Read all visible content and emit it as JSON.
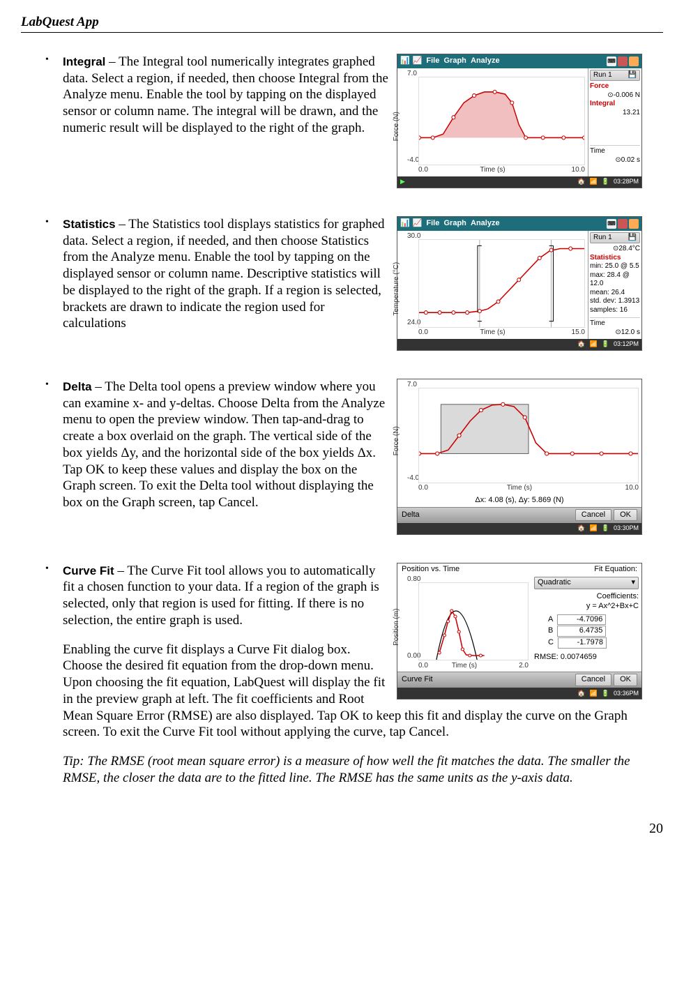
{
  "header": "LabQuest App",
  "page_number": "20",
  "bullets": {
    "integral": {
      "term": "Integral",
      "text": " – The Integral tool numerically integrates graphed data. Select a region, if needed, then choose Integral from the Analyze menu. Enable the tool by tapping on the displayed sensor or column name. The integral will be drawn, and the numeric result will be displayed to the right of the graph."
    },
    "statistics": {
      "term": "Statistics",
      "text": " – The Statistics tool displays statistics for graphed data. Select a region, if needed, and then choose Statistics from the Analyze menu. Enable the tool by tapping on the displayed sensor or column name. Descriptive statistics will be displayed to the right of the graph. If a region is selected, brackets are drawn to indicate the region used for calculations"
    },
    "delta": {
      "term": "Delta",
      "text": " – The Delta tool opens a preview window where you can examine x- and y-deltas. Choose Delta from the Analyze menu to open the preview window. Then tap-and-drag to create a box overlaid on the graph. The vertical side of the box yields Δy, and the horizontal side of the box yields Δx. Tap OK to keep these values and display the box on the Graph screen. To exit the Delta tool without displaying the box on  the Graph screen, tap Cancel."
    },
    "curvefit": {
      "term": "Curve Fit",
      "text1": " – The Curve Fit tool allows you to automatically fit a chosen function to your data. If a region of the graph is selected, only that region is used for fitting. If there is no selection, the entire graph is used.",
      "text2": "Enabling the curve fit displays a Curve Fit dialog box. Choose the desired fit equation from the drop-down menu. Upon choosing the fit equation, LabQuest will display the fit in the preview graph at left. The fit coefficients and Root Mean Square Error (RMSE) are also displayed. Tap OK to keep this fit and display the curve on the Graph screen. To exit the Curve Fit tool without applying the curve, tap Cancel.",
      "tip": "Tip: The RMSE (root mean square error) is a measure of how well the fit matches the data. The smaller the RMSE, the closer the data are to the fitted line. The RMSE has the same units as the y-axis data."
    }
  },
  "menus": {
    "file": "File",
    "graph": "Graph",
    "analyze": "Analyze"
  },
  "shot1": {
    "run": "Run 1",
    "force_label": "Force",
    "force_val": "⊙-0.006 N",
    "integral_label": "Integral",
    "integral_val": "13.21",
    "time_label": "Time",
    "time_val": "⊙0.02 s",
    "ylabel": "Force (N)",
    "xlabel": "Time (s)",
    "ymax": "7.0",
    "ymin": "-4.0",
    "xmin": "0.0",
    "xmax": "10.0",
    "clock": "03:28PM"
  },
  "shot2": {
    "run": "Run 1",
    "cur_val": "⊙28.4°C",
    "stats_label": "Statistics",
    "min": "min: 25.0 @ 5.5",
    "max": "max: 28.4 @ 12.0",
    "mean": "mean: 26.4",
    "std": "std. dev: 1.3913",
    "samples": "samples: 16",
    "time_label": "Time",
    "time_val": "⊙12.0 s",
    "ylabel": "Temperature (°C)",
    "xlabel": "Time (s)",
    "ymax": "30.0",
    "ymin": "24.0",
    "xmin": "0.0",
    "xmax": "15.0",
    "clock": "03:12PM"
  },
  "shot3": {
    "ylabel": "Force (N)",
    "xlabel": "Time (s)",
    "ymax": "7.0",
    "ymin": "-4.0",
    "xmin": "0.0",
    "xmax": "10.0",
    "delta_text": "Δx: 4.08 (s), Δy: 5.869 (N)",
    "title": "Delta",
    "cancel": "Cancel",
    "ok": "OK",
    "clock": "03:30PM"
  },
  "shot4": {
    "chart_title": "Position vs. Time",
    "fit_title": "Fit Equation:",
    "ylabel": "Position (m)",
    "xlabel": "Time (s)",
    "ymax": "0.80",
    "ymin": "0.00",
    "xmin": "0.0",
    "xmax": "2.0",
    "eq_type": "Quadratic",
    "coef_label": "Coefficients:",
    "equation": "y = Ax^2+Bx+C",
    "A": "-4.7096",
    "B": "6.4735",
    "C": "-1.7978",
    "A_lbl": "A",
    "B_lbl": "B",
    "C_lbl": "C",
    "rmse": "RMSE: 0.0074659",
    "title": "Curve Fit",
    "cancel": "Cancel",
    "ok": "OK",
    "clock": "03:36PM"
  },
  "chart_data": [
    {
      "type": "line",
      "title": "Force vs Time (Integral)",
      "xlabel": "Time (s)",
      "ylabel": "Force (N)",
      "xlim": [
        0,
        10
      ],
      "ylim": [
        -4,
        7
      ],
      "series": [
        {
          "name": "Force",
          "x": [
            0,
            0.5,
            1,
            1.5,
            2,
            2.5,
            3,
            3.5,
            4,
            4.5,
            5,
            5.5,
            6,
            6.5,
            7,
            7.5,
            8,
            8.5,
            9,
            9.5,
            10
          ],
          "y": [
            -0.1,
            -0.1,
            0.2,
            1.5,
            3.2,
            4.5,
            5.1,
            5.3,
            5.3,
            5.0,
            4.0,
            1.5,
            -0.1,
            -0.1,
            -0.1,
            -0.1,
            -0.1,
            -0.1,
            -0.1,
            -0.1,
            -0.1
          ]
        }
      ],
      "integral_fill": true
    },
    {
      "type": "line",
      "title": "Temperature vs Time (Statistics)",
      "xlabel": "Time (s)",
      "ylabel": "Temperature (°C)",
      "xlim": [
        0,
        15
      ],
      "ylim": [
        24,
        30
      ],
      "series": [
        {
          "name": "Temperature",
          "x": [
            0,
            1,
            2,
            3,
            4,
            5,
            5.5,
            6,
            7,
            8,
            9,
            10,
            11,
            12,
            13,
            14,
            15
          ],
          "y": [
            25,
            25,
            25,
            25,
            25,
            25,
            25,
            25.3,
            25.6,
            26.2,
            27,
            27.7,
            28.2,
            28.4,
            28.4,
            28.4,
            28.4
          ]
        }
      ],
      "selection": {
        "x0": 5.5,
        "x1": 12.0
      }
    },
    {
      "type": "line",
      "title": "Force vs Time (Delta)",
      "xlabel": "Time (s)",
      "ylabel": "Force (N)",
      "xlim": [
        0,
        10
      ],
      "ylim": [
        -4,
        7
      ],
      "series": [
        {
          "name": "Force",
          "x": [
            0,
            0.5,
            1,
            1.5,
            2,
            2.5,
            3,
            3.5,
            4,
            4.5,
            5,
            5.5,
            6,
            6.5,
            7,
            7.5,
            8,
            8.5,
            9,
            9.5,
            10
          ],
          "y": [
            -0.1,
            -0.1,
            0.2,
            1.5,
            3.2,
            4.5,
            5.1,
            5.3,
            5.3,
            5.0,
            4.0,
            1.5,
            -0.1,
            -0.1,
            -0.1,
            -0.1,
            -0.1,
            -0.1,
            -0.1,
            -0.1,
            -0.1
          ]
        }
      ],
      "delta_box": {
        "x0": 1.0,
        "x1": 5.08,
        "y0": -0.1,
        "y1": 5.77
      }
    },
    {
      "type": "scatter",
      "title": "Position vs. Time (Curve Fit)",
      "xlabel": "Time (s)",
      "ylabel": "Position (m)",
      "xlim": [
        0,
        2
      ],
      "ylim": [
        0,
        0.8
      ],
      "series": [
        {
          "name": "Position",
          "x": [
            0.4,
            0.5,
            0.55,
            0.6,
            0.65,
            0.7,
            0.75,
            0.8,
            0.85,
            0.9,
            0.95,
            1.0
          ],
          "y": [
            0.12,
            0.3,
            0.39,
            0.46,
            0.38,
            0.22,
            0.05,
            0.04,
            0.04,
            0.04,
            0.04,
            0.04
          ]
        }
      ],
      "fit": {
        "type": "quadratic",
        "A": -4.7096,
        "B": 6.4735,
        "C": -1.7978
      }
    }
  ]
}
